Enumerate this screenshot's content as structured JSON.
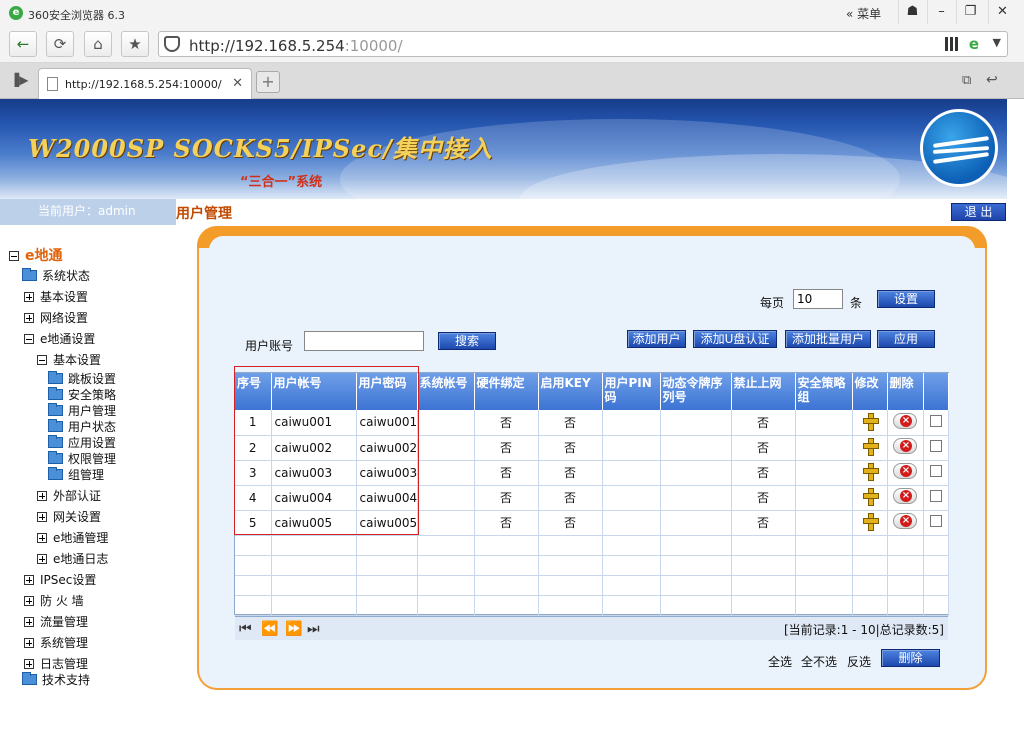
{
  "browser": {
    "title": "360安全浏览器 6.3",
    "menu_label": "菜单",
    "url_host": "http://192.168.5.254",
    "url_rest": ":10000/",
    "tab_label": "http://192.168.5.254:10000/"
  },
  "banner": {
    "title": "W2000SP SOCKS5/IPSec/集中接入",
    "subtitle": "“三合一”系统"
  },
  "userbar": {
    "current_user": "当前用户：admin",
    "section_title": "用户管理",
    "logout_label": "退 出"
  },
  "sidebar": {
    "root": "e地通",
    "items": [
      {
        "label": "系统状态"
      },
      {
        "label": "基本设置"
      },
      {
        "label": "网络设置"
      },
      {
        "label": "e地通设置"
      },
      {
        "label": "基本设置"
      },
      {
        "label": "跳板设置"
      },
      {
        "label": "安全策略"
      },
      {
        "label": "用户管理"
      },
      {
        "label": "用户状态"
      },
      {
        "label": "应用设置"
      },
      {
        "label": "权限管理"
      },
      {
        "label": "组管理"
      },
      {
        "label": "外部认证"
      },
      {
        "label": "网关设置"
      },
      {
        "label": "e地通管理"
      },
      {
        "label": "e地通日志"
      },
      {
        "label": "IPSec设置"
      },
      {
        "label": "防 火 墙"
      },
      {
        "label": "流量管理"
      },
      {
        "label": "系统管理"
      },
      {
        "label": "日志管理"
      },
      {
        "label": "技术支持"
      }
    ]
  },
  "toolbar": {
    "per_page_label": "每页",
    "per_page_value": "10",
    "per_page_unit": "条",
    "set_label": "设置",
    "account_label": "用户账号",
    "account_value": "",
    "search_label": "搜索",
    "add_user_label": "添加用户",
    "add_usb_label": "添加U盘认证",
    "add_batch_label": "添加批量用户",
    "apply_label": "应用"
  },
  "table": {
    "headers": [
      "序号",
      "用户帐号",
      "用户密码",
      "系统帐号",
      "硬件绑定",
      "启用KEY",
      "用户PIN码",
      "动态令牌序列号",
      "禁止上网",
      "安全策略组",
      "修改",
      "删除",
      ""
    ],
    "rows": [
      {
        "no": "1",
        "account": "caiwu001",
        "password": "caiwu001",
        "hw": "否",
        "key": "否",
        "block": "否"
      },
      {
        "no": "2",
        "account": "caiwu002",
        "password": "caiwu002",
        "hw": "否",
        "key": "否",
        "block": "否"
      },
      {
        "no": "3",
        "account": "caiwu003",
        "password": "caiwu003",
        "hw": "否",
        "key": "否",
        "block": "否"
      },
      {
        "no": "4",
        "account": "caiwu004",
        "password": "caiwu004",
        "hw": "否",
        "key": "否",
        "block": "否"
      },
      {
        "no": "5",
        "account": "caiwu005",
        "password": "caiwu005",
        "hw": "否",
        "key": "否",
        "block": "否"
      }
    ],
    "record_info": "[当前记录:1 - 10|总记录数:5]"
  },
  "footer": {
    "select_all": "全选",
    "select_none": "全不选",
    "invert": "反选",
    "delete_label": "删除"
  },
  "colors": {
    "accent_orange": "#f39c2a",
    "header_blue": "#3d74d4",
    "highlight_red": "#d42020"
  }
}
